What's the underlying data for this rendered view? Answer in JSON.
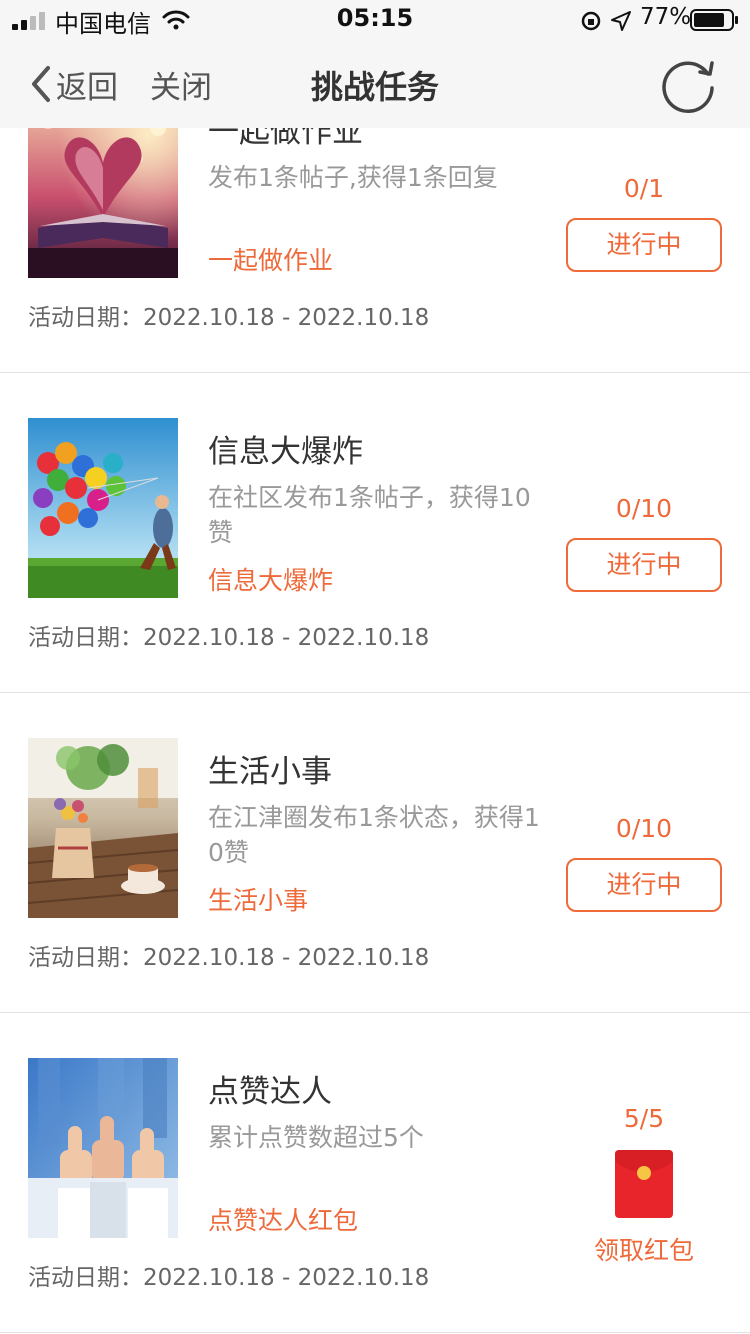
{
  "status_bar": {
    "carrier": "中国电信",
    "time": "05:15",
    "battery": "77%"
  },
  "nav": {
    "back_label": "返回",
    "close_label": "关闭",
    "title": "挑战任务"
  },
  "tasks": [
    {
      "title": "一起做作业",
      "description": "发布1条帖子,获得1条回复",
      "tag": "一起做作业",
      "date": "活动日期：2022.10.18 - 2022.10.18",
      "progress": "0/1",
      "status": "进行中"
    },
    {
      "title": "信息大爆炸",
      "description": "在社区发布1条帖子，获得10赞",
      "tag": "信息大爆炸",
      "date": "活动日期：2022.10.18 - 2022.10.18",
      "progress": "0/10",
      "status": "进行中"
    },
    {
      "title": "生活小事",
      "description": "在江津圈发布1条状态，获得10赞",
      "tag": "生活小事",
      "date": "活动日期：2022.10.18 - 2022.10.18",
      "progress": "0/10",
      "status": "进行中"
    },
    {
      "title": "点赞达人",
      "description": "累计点赞数超过5个",
      "tag": "点赞达人红包",
      "date": "活动日期：2022.10.18 - 2022.10.18",
      "progress": "5/5",
      "status": "领取红包"
    }
  ],
  "colors": {
    "accent": "#ee6a3a",
    "header_bg": "#f6f6f6",
    "red_packet": "#e8252a"
  }
}
